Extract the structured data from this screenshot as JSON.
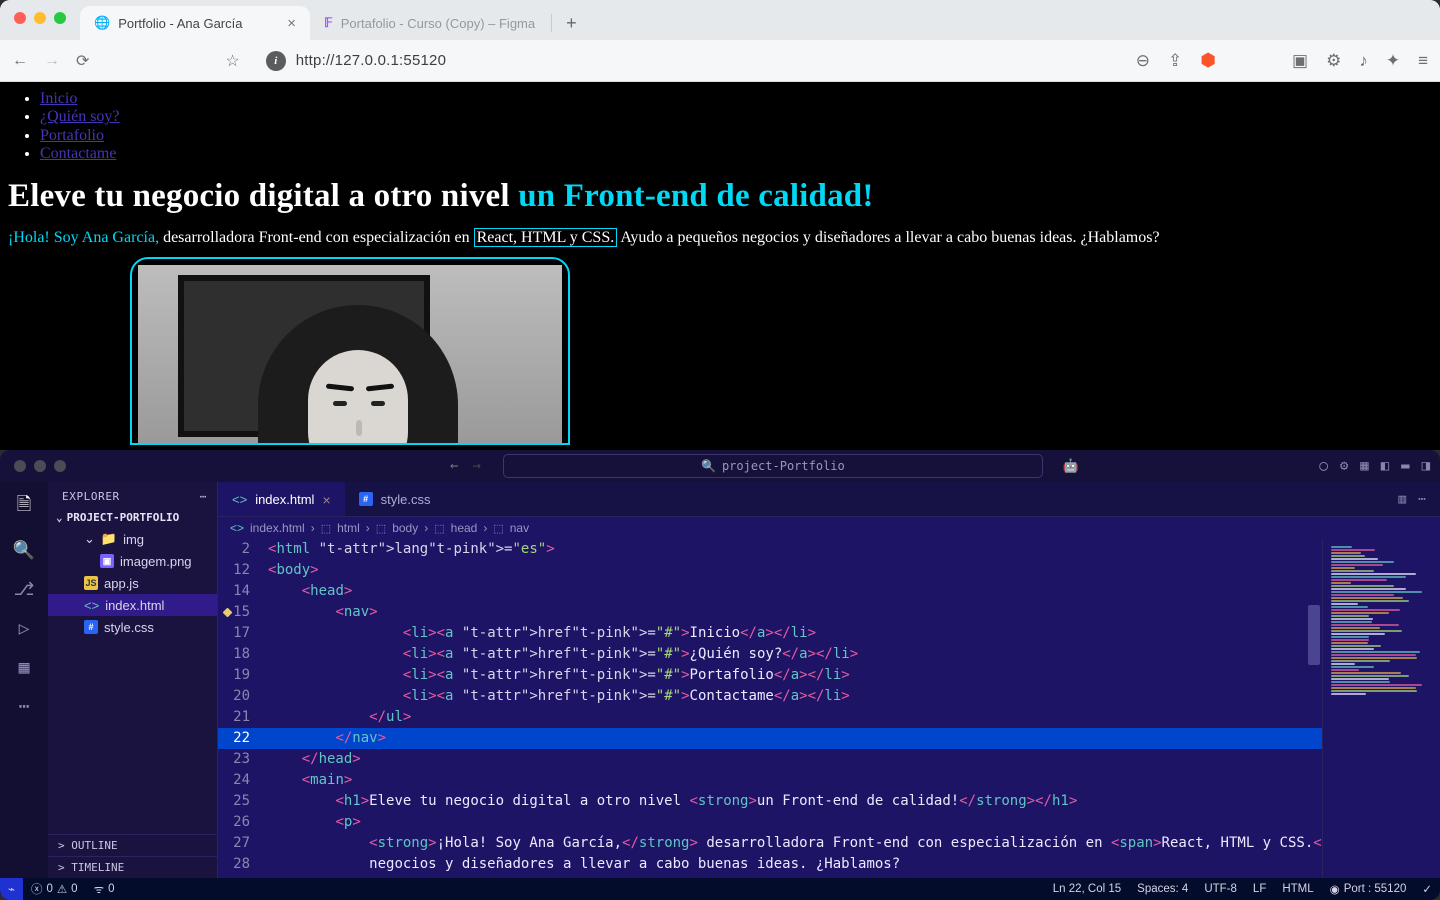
{
  "browser": {
    "tabs": [
      {
        "title": "Portfolio - Ana García",
        "active": true,
        "favicon": "◌"
      },
      {
        "title": "Portafolio - Curso (Copy) – Figma",
        "active": false,
        "favicon": "F"
      }
    ],
    "url": "http://127.0.0.1:55120"
  },
  "page": {
    "nav": [
      "Inicio",
      "¿Quién soy?",
      "Portafolio",
      "Contactame"
    ],
    "h1_plain": "Eleve tu negocio digital a otro nivel ",
    "h1_accent": "un Front-end de calidad!",
    "intro_strong": "¡Hola! Soy Ana García, ",
    "intro_mid": "desarrolladora Front-end con especialización en ",
    "intro_box": "React, HTML y CSS.",
    "intro_tail": " Ayudo a pequeños negocios y diseñadores a llevar a cabo buenas ideas. ¿Hablamos?"
  },
  "vscode": {
    "search_placeholder": "project-Portfolio",
    "explorer_label": "EXPLORER",
    "project_name": "PROJECT-PORTFOLIO",
    "tree": {
      "folder": "img",
      "files_in_folder": [
        "imagem.png"
      ],
      "root_files": [
        "app.js",
        "index.html",
        "style.css"
      ],
      "selected": "index.html"
    },
    "outline_label": "OUTLINE",
    "timeline_label": "TIMELINE",
    "tabs": [
      {
        "name": "index.html",
        "active": true
      },
      {
        "name": "style.css",
        "active": false
      }
    ],
    "breadcrumb": [
      "index.html",
      "html",
      "body",
      "head",
      "nav"
    ],
    "code": {
      "lines": [
        {
          "n": 2,
          "indent": 0,
          "raw": "<html lang=\"es\">"
        },
        {
          "n": 12,
          "indent": 0,
          "raw": "<body>"
        },
        {
          "n": 14,
          "indent": 1,
          "raw": "<head>"
        },
        {
          "n": 15,
          "indent": 2,
          "raw": "<nav>",
          "warn": true
        },
        {
          "n": 17,
          "indent": 4,
          "raw": "<li><a href=\"#\">Inicio</a></li>"
        },
        {
          "n": 18,
          "indent": 4,
          "raw": "<li><a href=\"#\">¿Quién soy?</a></li>"
        },
        {
          "n": 19,
          "indent": 4,
          "raw": "<li><a href=\"#\">Portafolio</a></li>"
        },
        {
          "n": 20,
          "indent": 4,
          "raw": "<li><a href=\"#\">Contactame</a></li>"
        },
        {
          "n": 21,
          "indent": 3,
          "raw": "</ul>"
        },
        {
          "n": 22,
          "indent": 2,
          "raw": "</nav>",
          "current": true
        },
        {
          "n": 23,
          "indent": 1,
          "raw": "</head>"
        },
        {
          "n": 24,
          "indent": 1,
          "raw": "<main>"
        },
        {
          "n": 25,
          "indent": 2,
          "raw": "<h1>Eleve tu negocio digital a otro nivel <strong>un Front-end de calidad!</strong></h1>"
        },
        {
          "n": 26,
          "indent": 2,
          "raw": "<p>"
        },
        {
          "n": 27,
          "indent": 3,
          "raw": "<strong>¡Hola! Soy Ana García,</strong> desarrolladora Front-end con especialización en <span>React, HTML y CSS.</"
        },
        {
          "n": 28,
          "indent": 3,
          "raw": "negocios y diseñadores a llevar a cabo buenas ideas. ¿Hablamos?"
        }
      ]
    },
    "status": {
      "errors": "0",
      "warnings": "0",
      "radio": "0",
      "cursor": "Ln 22, Col 15",
      "spaces": "Spaces: 4",
      "encoding": "UTF-8",
      "eol": "LF",
      "lang": "HTML",
      "port": "Port : 55120"
    }
  }
}
